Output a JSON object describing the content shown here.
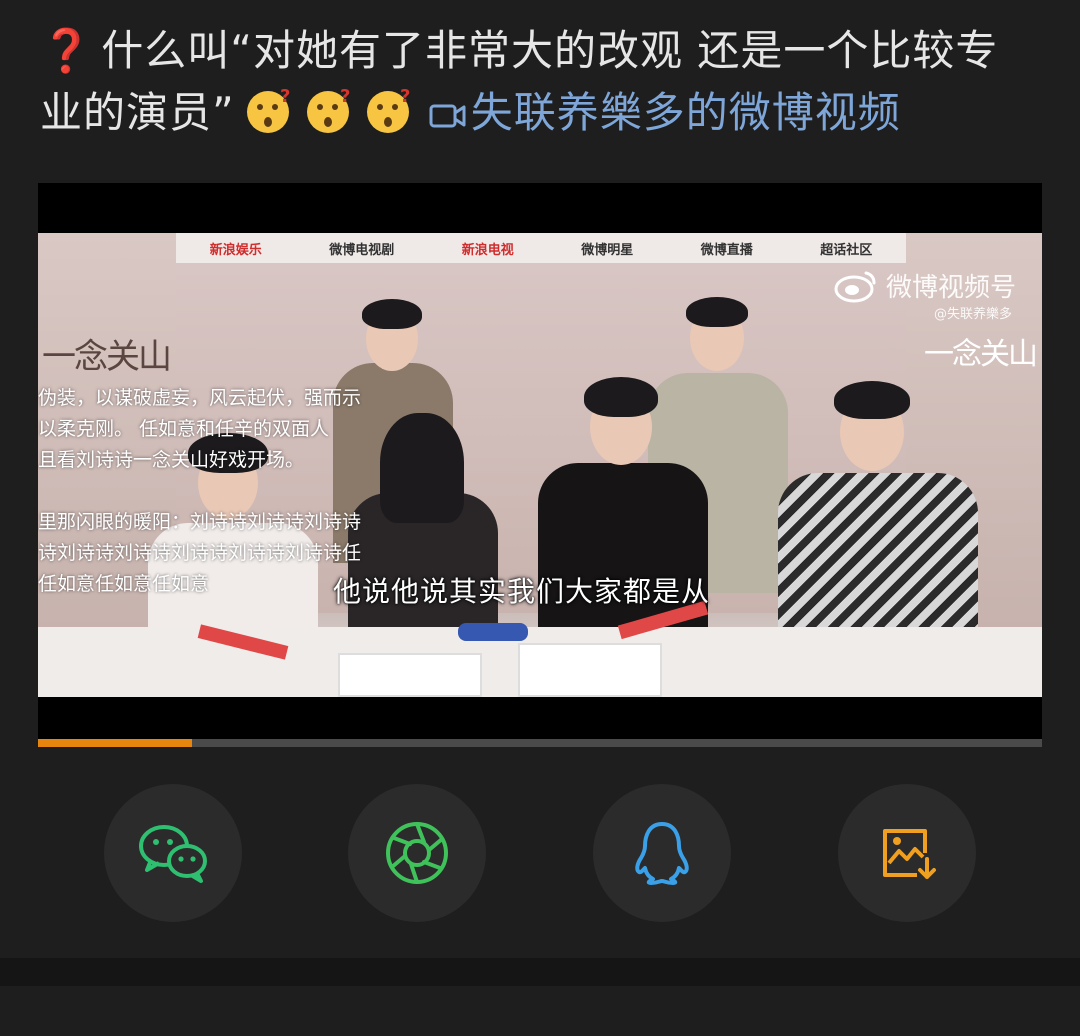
{
  "post": {
    "question_mark": "❓",
    "text": "什么叫“对她有了非常大的改观 还是一个比较专业的演员”",
    "emoji_name": "thinking-face-icon",
    "video_link": "失联养樂多的微博视频"
  },
  "video": {
    "sponsors": [
      "新浪娱乐",
      "微博电视剧",
      "新浪电视",
      "微博明星",
      "微博直播",
      "超话社区"
    ],
    "show_title": "一念关山",
    "watermark": "微博视频号",
    "watermark_handle": "@失联养樂多",
    "overlay_lines": "伪装，以谋破虚妄，风云起伏，强而示\n以柔克刚。 任如意和任辛的双面人\n且看刘诗诗一念关山好戏开场。\n\n里那闪眼的暖阳：刘诗诗刘诗诗刘诗诗\n诗刘诗诗刘诗诗刘诗诗刘诗诗刘诗诗任\n任如意任如意任如意",
    "subtitle": "他说他说其实我们大家都是从",
    "progress": 0.153,
    "colors": {
      "progress": "#e8850f",
      "track": "#4a4a4a"
    }
  },
  "share": [
    {
      "name": "wechat",
      "icon": "wechat-icon",
      "color": "#2fbf71"
    },
    {
      "name": "moments",
      "icon": "moments-shutter-icon",
      "color": "#3fc25a"
    },
    {
      "name": "qq",
      "icon": "qq-penguin-icon",
      "color": "#3aa0e8"
    },
    {
      "name": "save-image",
      "icon": "save-image-icon",
      "color": "#f0a020"
    }
  ]
}
